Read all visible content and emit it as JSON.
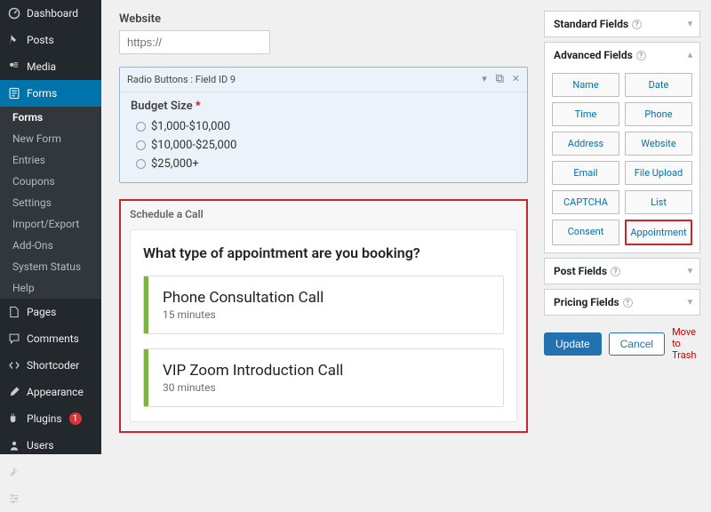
{
  "sidebar": {
    "items": [
      {
        "label": "Dashboard"
      },
      {
        "label": "Posts"
      },
      {
        "label": "Media"
      },
      {
        "label": "Forms"
      },
      {
        "label": "Pages"
      },
      {
        "label": "Comments"
      },
      {
        "label": "Shortcoder"
      },
      {
        "label": "Appearance"
      },
      {
        "label": "Plugins",
        "badge": "1"
      },
      {
        "label": "Users"
      },
      {
        "label": "Tools"
      },
      {
        "label": "Settings"
      }
    ],
    "forms_sub": [
      "Forms",
      "New Form",
      "Entries",
      "Coupons",
      "Settings",
      "Import/Export",
      "Add-Ons",
      "System Status",
      "Help"
    ]
  },
  "form": {
    "website_label": "Website",
    "website_placeholder": "https://",
    "selected_field_header": "Radio Buttons : Field ID 9",
    "budget_label": "Budget Size",
    "budget_required": "*",
    "budget_options": [
      "$1,000-$10,000",
      "$10,000-$25,000",
      "$25,000+"
    ],
    "schedule_block_title": "Schedule a Call",
    "appt_question": "What type of appointment are you booking?",
    "appt_options": [
      {
        "name": "Phone Consultation Call",
        "duration": "15 minutes"
      },
      {
        "name": "VIP Zoom Introduction Call",
        "duration": "30 minutes"
      }
    ]
  },
  "panels": {
    "standard": "Standard Fields",
    "advanced": "Advanced Fields",
    "advanced_tags": [
      "Name",
      "Date",
      "Time",
      "Phone",
      "Address",
      "Website",
      "Email",
      "File Upload",
      "CAPTCHA",
      "List",
      "Consent",
      "Appointment"
    ],
    "post": "Post Fields",
    "pricing": "Pricing Fields"
  },
  "actions": {
    "update": "Update",
    "cancel": "Cancel",
    "trash": "Move to Trash"
  }
}
